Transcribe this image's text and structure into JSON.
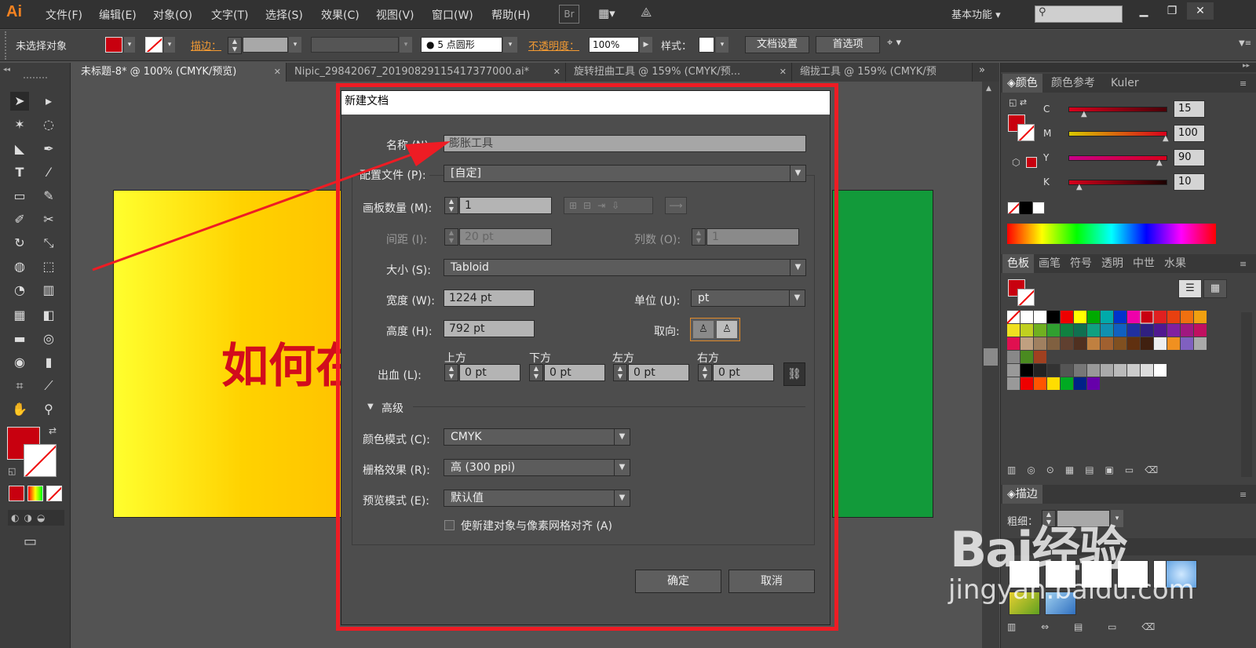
{
  "app": {
    "logo": "Ai"
  },
  "menu": [
    "文件(F)",
    "编辑(E)",
    "对象(O)",
    "文字(T)",
    "选择(S)",
    "效果(C)",
    "视图(V)",
    "窗口(W)",
    "帮助(H)"
  ],
  "menu_right": {
    "bridge": "Br",
    "workspace": "基本功能"
  },
  "control_bar": {
    "status": "未选择对象",
    "stroke_label": "描边：",
    "brush": "5 点圆形",
    "opacity_label": "不透明度：",
    "opacity_value": "100%",
    "style_label": "样式：",
    "doc_setup": "文档设置",
    "preferences": "首选项"
  },
  "tabs": [
    "未标题-8* @ 100% (CMYK/预览)",
    "Nipic_29842067_20190829115417377000.ai*",
    "旋转扭曲工具 @ 159% (CMYK/预...",
    "缩拢工具 @ 159% (CMYK/预"
  ],
  "artboard_text": "如何在",
  "dialog": {
    "title": "新建文档",
    "name_label": "名称 (N):",
    "name_value": "膨胀工具",
    "profile_label": "配置文件 (P):",
    "profile_value": "[自定]",
    "artboards_label": "画板数量 (M):",
    "artboards_value": "1",
    "spacing_label": "间距 (I):",
    "spacing_value": "20 pt",
    "columns_label": "列数 (O):",
    "columns_value": "1",
    "size_label": "大小 (S):",
    "size_value": "Tabloid",
    "width_label": "宽度 (W):",
    "width_value": "1224 pt",
    "units_label": "单位 (U):",
    "units_value": "pt",
    "height_label": "高度 (H):",
    "height_value": "792 pt",
    "orientation_label": "取向:",
    "bleed_label": "出血 (L):",
    "bleed_top_label": "上方",
    "bleed_bottom_label": "下方",
    "bleed_left_label": "左方",
    "bleed_right_label": "右方",
    "bleed_top": "0 pt",
    "bleed_bottom": "0 pt",
    "bleed_left": "0 pt",
    "bleed_right": "0 pt",
    "advanced_label": "高级",
    "color_mode_label": "颜色模式 (C):",
    "color_mode_value": "CMYK",
    "raster_label": "栅格效果 (R):",
    "raster_value": "高 (300 ppi)",
    "preview_label": "预览模式 (E):",
    "preview_value": "默认值",
    "align_pixel_label": "使新建对象与像素网格对齐 (A)",
    "ok": "确定",
    "cancel": "取消"
  },
  "color_panel": {
    "tabs": [
      "颜色",
      "颜色参考",
      "Kuler"
    ],
    "channels": [
      {
        "name": "C",
        "value": "15"
      },
      {
        "name": "M",
        "value": "100"
      },
      {
        "name": "Y",
        "value": "90"
      },
      {
        "name": "K",
        "value": "10"
      }
    ]
  },
  "swatch_panel": {
    "tabs": [
      "色板",
      "画笔",
      "符号",
      "透明",
      "中世",
      "水果"
    ]
  },
  "stroke_panel": {
    "title": "描边",
    "weight_label": "粗细："
  },
  "watermark": {
    "text": "Bai经验",
    "url": "jingyan.baidu.com"
  },
  "colors": {
    "fill": "#c8000f",
    "accent": "#f29a33",
    "highlight": "#ee1c24"
  }
}
